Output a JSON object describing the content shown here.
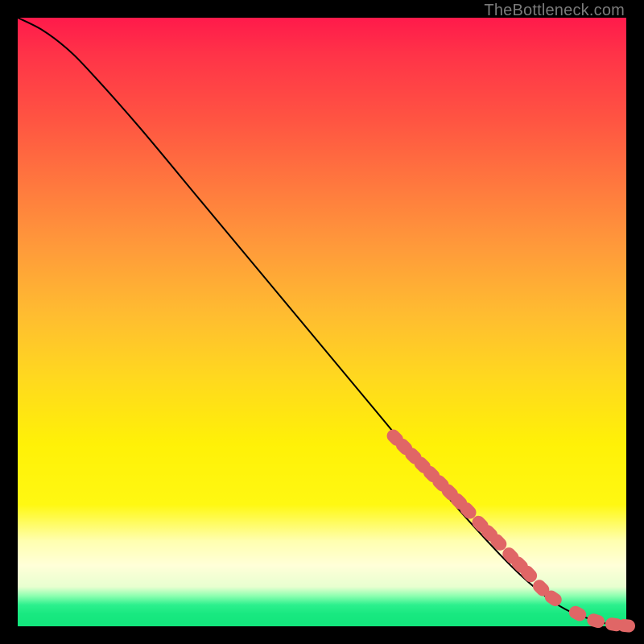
{
  "watermark": "TheBottleneck.com",
  "colors": {
    "background": "#000000",
    "curve": "#000000",
    "marker_fill": "#e06666",
    "marker_stroke": "#c24f4f"
  },
  "chart_data": {
    "type": "line",
    "title": "",
    "xlabel": "",
    "ylabel": "",
    "xlim": [
      0,
      100
    ],
    "ylim": [
      0,
      100
    ],
    "curve": {
      "x": [
        0,
        4,
        8,
        12,
        20,
        30,
        40,
        50,
        60,
        70,
        80,
        86,
        90,
        94,
        97,
        100
      ],
      "y": [
        100,
        98,
        95,
        91,
        82,
        70,
        58,
        46,
        34,
        22,
        11,
        5.5,
        2.8,
        1.2,
        0.4,
        0.1
      ]
    },
    "series": [
      {
        "name": "highlighted-range",
        "x": [
          62,
          63.5,
          65,
          66.5,
          68,
          69.5,
          71,
          72.5,
          74,
          76,
          77.5,
          79,
          81,
          82.5,
          84,
          86,
          88,
          92,
          95,
          98,
          100
        ],
        "y": [
          31,
          29.5,
          28,
          26.5,
          25,
          23.5,
          22,
          20.5,
          19,
          16.8,
          15.3,
          13.8,
          11.6,
          10.1,
          8.6,
          6.3,
          4.6,
          2.1,
          0.9,
          0.3,
          0.1
        ]
      }
    ]
  }
}
